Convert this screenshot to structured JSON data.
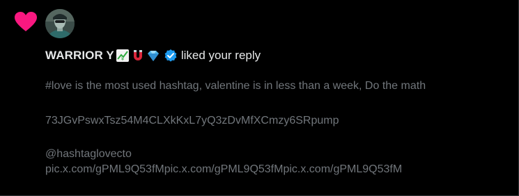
{
  "notification": {
    "icon": "heart-icon",
    "icon_color": "#f91880",
    "avatar": "avatar-image",
    "user": {
      "name": "WARRIOR Y",
      "badges": [
        "chart-yen-emoji",
        "magnet-emoji",
        "gem-emoji"
      ],
      "verified": true,
      "verified_color": "#1d9bf0"
    },
    "action_text": "liked your reply"
  },
  "reply": {
    "line1": "#love is the most used hashtag, valentine is in less than a week, Do the math",
    "line2": "73JGvPswxTsz54M4CLXkKxL7yQ3zDvMfXCmzy6SRpump",
    "line3": "@hashtaglovecto",
    "line4": "pic.x.com/gPML9Q53fMpic.x.com/gPML9Q53fMpic.x.com/gPML9Q53fM",
    "text_color": "#71767b"
  }
}
